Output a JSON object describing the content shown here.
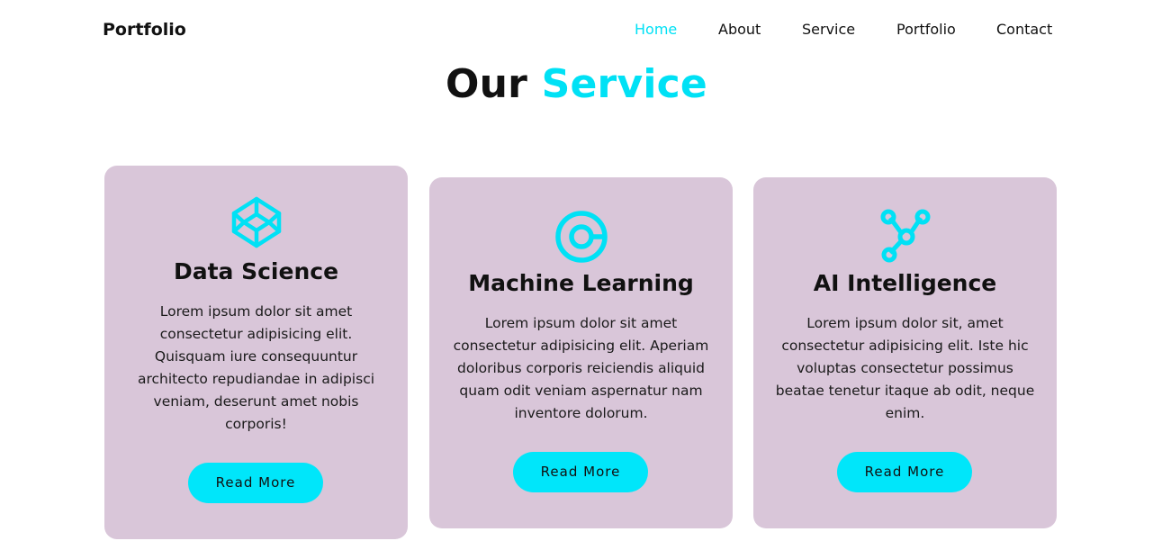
{
  "header": {
    "logo": "Portfolio",
    "nav": [
      {
        "label": "Home",
        "active": true
      },
      {
        "label": "About",
        "active": false
      },
      {
        "label": "Service",
        "active": false
      },
      {
        "label": "Portfolio",
        "active": false
      },
      {
        "label": "Contact",
        "active": false
      }
    ]
  },
  "services": {
    "title_main": "Our",
    "title_accent": "Service",
    "cards": [
      {
        "icon": "codepen-cube-icon",
        "title": "Data Science",
        "description": "Lorem ipsum dolor sit amet consectetur adipisicing elit. Quisquam iure consequuntur architecto repudiandae in adipisci veniam, deserunt amet nobis corporis!",
        "button": "Read More"
      },
      {
        "icon": "donut-chart-icon",
        "title": "Machine Learning",
        "description": "Lorem ipsum dolor sit amet consectetur adipisicing elit. Aperiam doloribus corporis reiciendis aliquid quam odit veniam aspernatur nam inventore dolorum.",
        "button": "Read More"
      },
      {
        "icon": "network-nodes-icon",
        "title": "AI Intelligence",
        "description": "Lorem ipsum dolor sit, amet consectetur adipisicing elit. Iste hic voluptas consectetur possimus beatae tenetur itaque ab odit, neque enim.",
        "button": "Read More"
      }
    ]
  },
  "colors": {
    "accent": "#00e1f5",
    "card_bg": "#d9c6d9",
    "button_bg": "#00e6fa"
  }
}
